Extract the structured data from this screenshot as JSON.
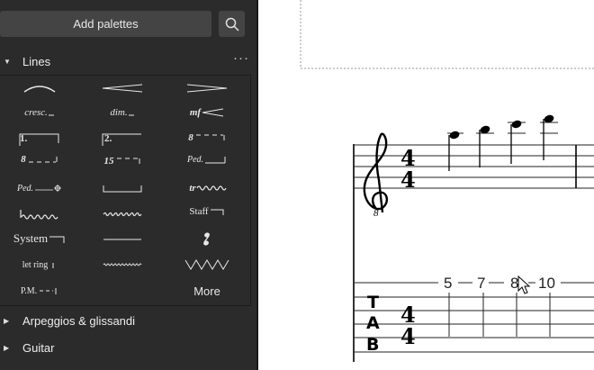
{
  "toolbar": {
    "add_palettes_label": "Add palettes",
    "search_icon": "search-icon"
  },
  "palettes": {
    "lines": {
      "label": "Lines",
      "expanded": true,
      "menu_icon": "more-dots-icon",
      "cells": {
        "slur": "slur-icon",
        "hairpin_cresc": "crescendo-hairpin-icon",
        "hairpin_dim": "diminuendo-hairpin-icon",
        "cresc_line": "cresc.",
        "dim_line": "dim.",
        "mf_hairpin": "mf",
        "volta1": "1.",
        "volta2": "2.",
        "ottava_up": "8",
        "ottava_down": "8",
        "fifteen": "15",
        "pedal_line": "Ped.",
        "pedal_star": "Ped.",
        "bracket_line": "line-bracket-icon",
        "trill": "tr",
        "arpeggio_line": "wavy-line-icon",
        "wavy_line": "wavy-line-icon",
        "staff_text_line": "Staff",
        "system_text_line": "System",
        "plain_line": "line-icon",
        "rest_glyph": "rest-icon",
        "let_ring": "let ring",
        "dotted_line": "dotted-line-icon",
        "zigzag": "zigzag-icon",
        "pm": "P.M.",
        "more_label": "More"
      }
    },
    "arpeggios": {
      "label": "Arpeggios & glissandi",
      "expanded": false
    },
    "guitar": {
      "label": "Guitar",
      "expanded": false
    }
  },
  "score": {
    "time_signature": {
      "top": "4",
      "bottom": "4"
    },
    "clef_octave": "8",
    "tab_label": [
      "T",
      "A",
      "B"
    ],
    "tab_numbers": [
      "5",
      "7",
      "8",
      "10"
    ],
    "cursor_icon": "mouse-cursor-icon"
  }
}
